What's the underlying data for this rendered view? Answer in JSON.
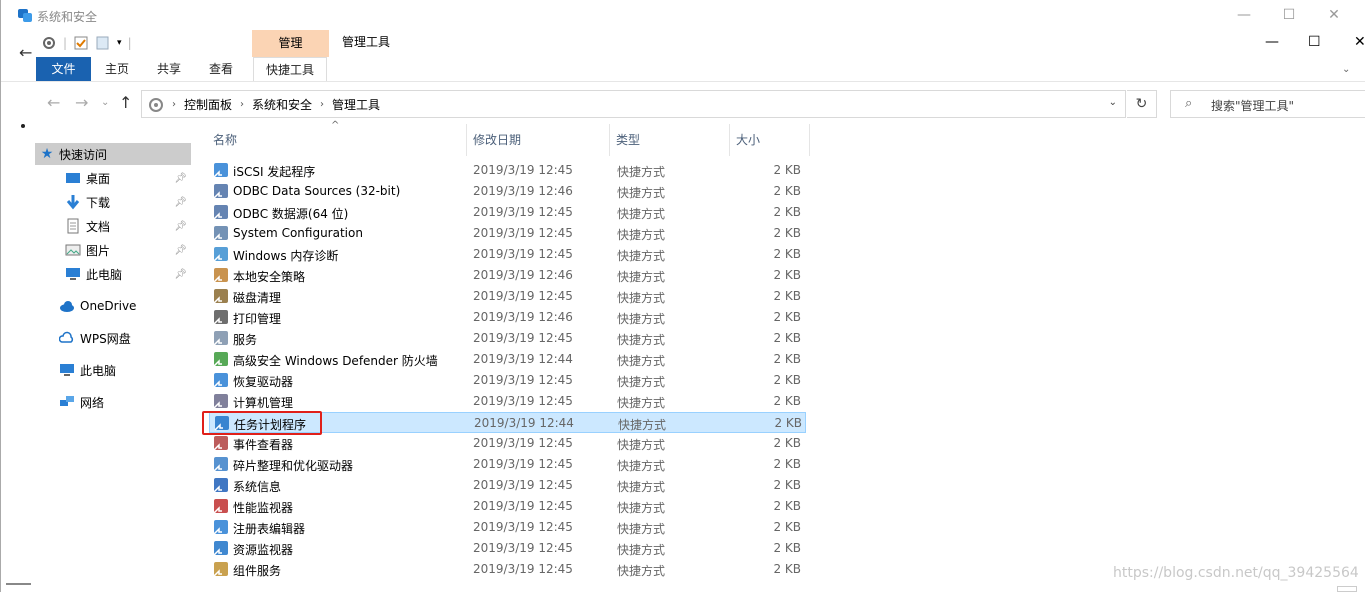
{
  "window": {
    "title": "系统和安全",
    "controls": {
      "minimize": "—",
      "maximize": "☐",
      "close": "✕"
    }
  },
  "ribbon": {
    "context_header": "管理",
    "context_title": "管理工具",
    "tabs": [
      "文件",
      "主页",
      "共享",
      "查看"
    ],
    "context_tab": "快捷工具"
  },
  "address": {
    "crumbs": [
      "控制面板",
      "系统和安全",
      "管理工具"
    ]
  },
  "search": {
    "placeholder": "搜索\"管理工具\""
  },
  "nav": {
    "quick_access": "快速访问",
    "pinned": [
      "桌面",
      "下载",
      "文档",
      "图片",
      "此电脑"
    ],
    "roots": [
      "OneDrive",
      "WPS网盘",
      "此电脑",
      "网络"
    ]
  },
  "columns": {
    "name": "名称",
    "date": "修改日期",
    "type": "类型",
    "size": "大小"
  },
  "files": [
    {
      "name": "iSCSI 发起程序",
      "date": "2019/3/19 12:45",
      "type": "快捷方式",
      "size": "2 KB",
      "icon": "iscsi-icon"
    },
    {
      "name": "ODBC Data Sources (32-bit)",
      "date": "2019/3/19 12:46",
      "type": "快捷方式",
      "size": "2 KB",
      "icon": "odbc-icon"
    },
    {
      "name": "ODBC 数据源(64 位)",
      "date": "2019/3/19 12:45",
      "type": "快捷方式",
      "size": "2 KB",
      "icon": "odbc-icon"
    },
    {
      "name": "System Configuration",
      "date": "2019/3/19 12:45",
      "type": "快捷方式",
      "size": "2 KB",
      "icon": "msconfig-icon"
    },
    {
      "name": "Windows 内存诊断",
      "date": "2019/3/19 12:45",
      "type": "快捷方式",
      "size": "2 KB",
      "icon": "memory-diag-icon"
    },
    {
      "name": "本地安全策略",
      "date": "2019/3/19 12:46",
      "type": "快捷方式",
      "size": "2 KB",
      "icon": "security-policy-icon"
    },
    {
      "name": "磁盘清理",
      "date": "2019/3/19 12:45",
      "type": "快捷方式",
      "size": "2 KB",
      "icon": "disk-cleanup-icon"
    },
    {
      "name": "打印管理",
      "date": "2019/3/19 12:46",
      "type": "快捷方式",
      "size": "2 KB",
      "icon": "printer-icon"
    },
    {
      "name": "服务",
      "date": "2019/3/19 12:45",
      "type": "快捷方式",
      "size": "2 KB",
      "icon": "services-icon"
    },
    {
      "name": "高级安全 Windows Defender 防火墙",
      "date": "2019/3/19 12:44",
      "type": "快捷方式",
      "size": "2 KB",
      "icon": "firewall-icon"
    },
    {
      "name": "恢复驱动器",
      "date": "2019/3/19 12:45",
      "type": "快捷方式",
      "size": "2 KB",
      "icon": "recovery-drive-icon"
    },
    {
      "name": "计算机管理",
      "date": "2019/3/19 12:45",
      "type": "快捷方式",
      "size": "2 KB",
      "icon": "computer-mgmt-icon"
    },
    {
      "name": "任务计划程序",
      "date": "2019/3/19 12:44",
      "type": "快捷方式",
      "size": "2 KB",
      "icon": "task-scheduler-icon",
      "selected": true
    },
    {
      "name": "事件查看器",
      "date": "2019/3/19 12:45",
      "type": "快捷方式",
      "size": "2 KB",
      "icon": "event-viewer-icon"
    },
    {
      "name": "碎片整理和优化驱动器",
      "date": "2019/3/19 12:45",
      "type": "快捷方式",
      "size": "2 KB",
      "icon": "defrag-icon"
    },
    {
      "name": "系统信息",
      "date": "2019/3/19 12:45",
      "type": "快捷方式",
      "size": "2 KB",
      "icon": "system-info-icon"
    },
    {
      "name": "性能监视器",
      "date": "2019/3/19 12:45",
      "type": "快捷方式",
      "size": "2 KB",
      "icon": "perf-monitor-icon"
    },
    {
      "name": "注册表编辑器",
      "date": "2019/3/19 12:45",
      "type": "快捷方式",
      "size": "2 KB",
      "icon": "regedit-icon"
    },
    {
      "name": "资源监视器",
      "date": "2019/3/19 12:45",
      "type": "快捷方式",
      "size": "2 KB",
      "icon": "resource-monitor-icon"
    },
    {
      "name": "组件服务",
      "date": "2019/3/19 12:45",
      "type": "快捷方式",
      "size": "2 KB",
      "icon": "component-services-icon"
    }
  ],
  "watermark": "https://blog.csdn.net/qq_39425564",
  "colors": {
    "file_tab": "#1a62b0",
    "context_header": "#fbd4b4",
    "selection": "#cce8ff",
    "highlight_box": "#e0201a"
  }
}
